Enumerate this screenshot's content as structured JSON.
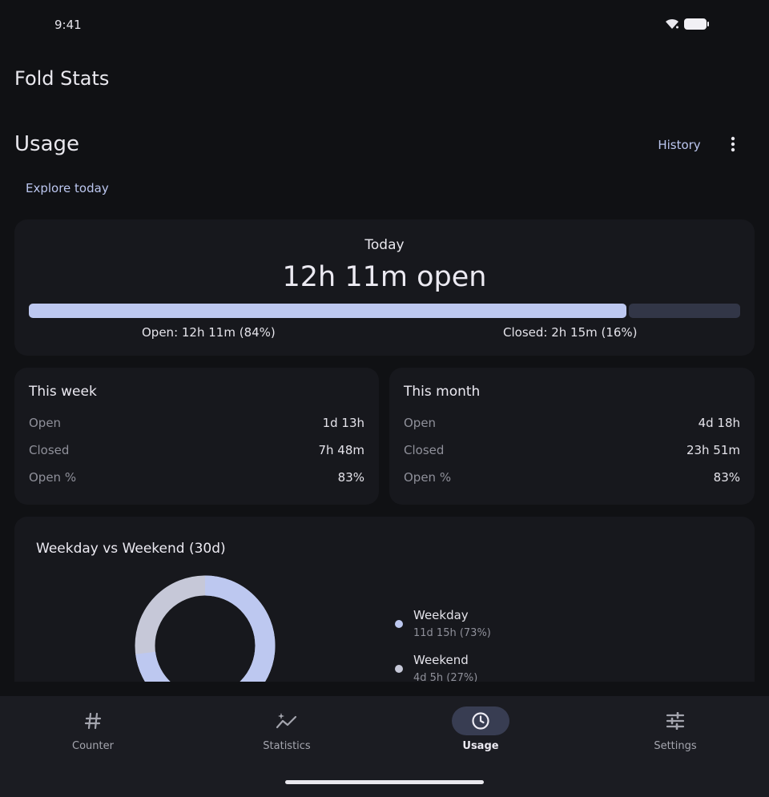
{
  "status_bar": {
    "time": "9:41"
  },
  "app": {
    "title": "Fold Stats"
  },
  "header": {
    "title": "Usage",
    "history_label": "History",
    "explore_label": "Explore today"
  },
  "today": {
    "label": "Today",
    "value": "12h 11m open",
    "open_fraction": 0.84,
    "open_caption": "Open: 12h 11m (84%)",
    "closed_caption": "Closed: 2h 15m (16%)"
  },
  "week": {
    "title": "This week",
    "rows": [
      {
        "label": "Open",
        "value": "1d 13h"
      },
      {
        "label": "Closed",
        "value": "7h 48m"
      },
      {
        "label": "Open %",
        "value": "83%"
      }
    ]
  },
  "month": {
    "title": "This month",
    "rows": [
      {
        "label": "Open",
        "value": "4d 18h"
      },
      {
        "label": "Closed",
        "value": "23h 51m"
      },
      {
        "label": "Open %",
        "value": "83%"
      }
    ]
  },
  "split": {
    "title": "Weekday vs Weekend (30d)",
    "legend": [
      {
        "name": "Weekday",
        "detail": "11d 15h (73%)",
        "fraction": 0.73,
        "color": "#bdc8f0"
      },
      {
        "name": "Weekend",
        "detail": "4d 5h (27%)",
        "fraction": 0.27,
        "color": "#c6c8d8"
      }
    ]
  },
  "nav": {
    "items": [
      {
        "label": "Counter",
        "icon": "hash-icon"
      },
      {
        "label": "Statistics",
        "icon": "sparkle-chart-icon"
      },
      {
        "label": "Usage",
        "icon": "clock-icon",
        "active": true
      },
      {
        "label": "Settings",
        "icon": "tune-icon"
      }
    ]
  },
  "colors": {
    "accent": "#bdc8f0",
    "background": "#101114",
    "card": "#17181d"
  }
}
